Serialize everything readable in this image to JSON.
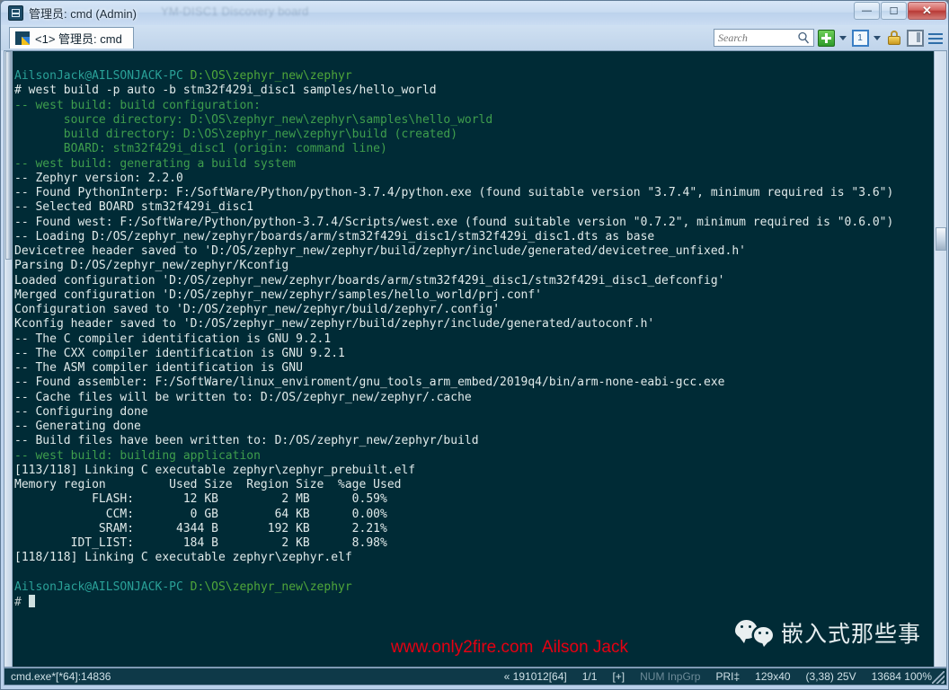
{
  "window": {
    "title": "管理员: cmd (Admin)",
    "ghost_title": "YM-DISC1 Discovery board",
    "app_icon": "console-icon",
    "buttons": {
      "minimize": "minimize-button",
      "maximize": "maximize-button",
      "close_label": "✕"
    }
  },
  "tabs": [
    {
      "label": "<1> 管理员: cmd",
      "icon": "cmd-tab-icon",
      "active": true
    }
  ],
  "toolbar": {
    "search_placeholder": "Search",
    "search_value": "",
    "search_icon": "search-icon",
    "new_console_icon": "plus-icon",
    "new_console_caret": "chevron-down-icon",
    "console_count_label": "1",
    "console_caret": "chevron-down-icon",
    "lock_icon": "lock-icon",
    "split_icon": "split-pane-icon",
    "menu_icon": "hamburger-menu-icon"
  },
  "terminal": {
    "lines": [
      [
        {
          "t": "AilsonJack@AILSONJACK-PC ",
          "c": "c-user"
        },
        {
          "t": "D:\\OS\\zephyr_new\\zephyr",
          "c": "c-path"
        }
      ],
      [
        {
          "t": "# west build -p auto -b stm32f429i_disc1 samples/hello_world",
          "c": "c-white"
        }
      ],
      [
        {
          "t": "-- west build: build configuration:",
          "c": "c-green"
        }
      ],
      [
        {
          "t": "       source directory: D:\\OS\\zephyr_new\\zephyr\\samples\\hello_world",
          "c": "c-green"
        }
      ],
      [
        {
          "t": "       build directory: D:\\OS\\zephyr_new\\zephyr\\build (created)",
          "c": "c-green"
        }
      ],
      [
        {
          "t": "       BOARD: stm32f429i_disc1 (origin: command line)",
          "c": "c-green"
        }
      ],
      [
        {
          "t": "-- west build: generating a build system",
          "c": "c-green"
        }
      ],
      [
        {
          "t": "-- Zephyr version: 2.2.0",
          "c": "c-white"
        }
      ],
      [
        {
          "t": "-- Found PythonInterp: F:/SoftWare/Python/python-3.7.4/python.exe (found suitable version \"3.7.4\", minimum required is \"3.6\")",
          "c": "c-white"
        }
      ],
      [
        {
          "t": "-- Selected BOARD stm32f429i_disc1",
          "c": "c-white"
        }
      ],
      [
        {
          "t": "-- Found west: F:/SoftWare/Python/python-3.7.4/Scripts/west.exe (found suitable version \"0.7.2\", minimum required is \"0.6.0\")",
          "c": "c-white"
        }
      ],
      [
        {
          "t": "-- Loading D:/OS/zephyr_new/zephyr/boards/arm/stm32f429i_disc1/stm32f429i_disc1.dts as base",
          "c": "c-white"
        }
      ],
      [
        {
          "t": "Devicetree header saved to 'D:/OS/zephyr_new/zephyr/build/zephyr/include/generated/devicetree_unfixed.h'",
          "c": "c-white"
        }
      ],
      [
        {
          "t": "Parsing D:/OS/zephyr_new/zephyr/Kconfig",
          "c": "c-white"
        }
      ],
      [
        {
          "t": "Loaded configuration 'D:/OS/zephyr_new/zephyr/boards/arm/stm32f429i_disc1/stm32f429i_disc1_defconfig'",
          "c": "c-white"
        }
      ],
      [
        {
          "t": "Merged configuration 'D:/OS/zephyr_new/zephyr/samples/hello_world/prj.conf'",
          "c": "c-white"
        }
      ],
      [
        {
          "t": "Configuration saved to 'D:/OS/zephyr_new/zephyr/build/zephyr/.config'",
          "c": "c-white"
        }
      ],
      [
        {
          "t": "Kconfig header saved to 'D:/OS/zephyr_new/zephyr/build/zephyr/include/generated/autoconf.h'",
          "c": "c-white"
        }
      ],
      [
        {
          "t": "-- The C compiler identification is GNU 9.2.1",
          "c": "c-white"
        }
      ],
      [
        {
          "t": "-- The CXX compiler identification is GNU 9.2.1",
          "c": "c-white"
        }
      ],
      [
        {
          "t": "-- The ASM compiler identification is GNU",
          "c": "c-white"
        }
      ],
      [
        {
          "t": "-- Found assembler: F:/SoftWare/linux_enviroment/gnu_tools_arm_embed/2019q4/bin/arm-none-eabi-gcc.exe",
          "c": "c-white"
        }
      ],
      [
        {
          "t": "-- Cache files will be written to: D:/OS/zephyr_new/zephyr/.cache",
          "c": "c-white"
        }
      ],
      [
        {
          "t": "-- Configuring done",
          "c": "c-white"
        }
      ],
      [
        {
          "t": "-- Generating done",
          "c": "c-white"
        }
      ],
      [
        {
          "t": "-- Build files have been written to: D:/OS/zephyr_new/zephyr/build",
          "c": "c-white"
        }
      ],
      [
        {
          "t": "-- west build: building application",
          "c": "c-green"
        }
      ],
      [
        {
          "t": "[113/118] Linking C executable zephyr\\zephyr_prebuilt.elf",
          "c": "c-white"
        }
      ],
      [
        {
          "t": "Memory region         Used Size  Region Size  %age Used",
          "c": "c-white"
        }
      ],
      [
        {
          "t": "           FLASH:       12 KB         2 MB      0.59%",
          "c": "c-white"
        }
      ],
      [
        {
          "t": "             CCM:        0 GB        64 KB      0.00%",
          "c": "c-white"
        }
      ],
      [
        {
          "t": "            SRAM:      4344 B       192 KB      2.21%",
          "c": "c-white"
        }
      ],
      [
        {
          "t": "        IDT_LIST:       184 B         2 KB      8.98%",
          "c": "c-white"
        }
      ],
      [
        {
          "t": "[118/118] Linking C executable zephyr\\zephyr.elf",
          "c": "c-white"
        }
      ],
      [
        {
          "t": "",
          "c": "c-white"
        }
      ],
      [
        {
          "t": "AilsonJack@AILSONJACK-PC ",
          "c": "c-user"
        },
        {
          "t": "D:\\OS\\zephyr_new\\zephyr",
          "c": "c-path"
        }
      ],
      [
        {
          "t": "# ",
          "c": "c-prompt"
        },
        {
          "cursor": true
        }
      ]
    ]
  },
  "overlays": {
    "watermark": "www.only2fire.com  Ailson Jack",
    "watermark_color": "#e60012",
    "wechat_name": "嵌入式那些事",
    "wechat_icon": "wechat-logo-icon"
  },
  "statusbar": {
    "left": "cmd.exe*[*64]:14836",
    "items": [
      "« 191012[64]",
      "1/1",
      "[+]",
      "NUM InpGrp",
      "PRI‡",
      "129x40",
      "(3,38) 25V",
      "13684 100%"
    ],
    "dim_item_index": 3
  }
}
